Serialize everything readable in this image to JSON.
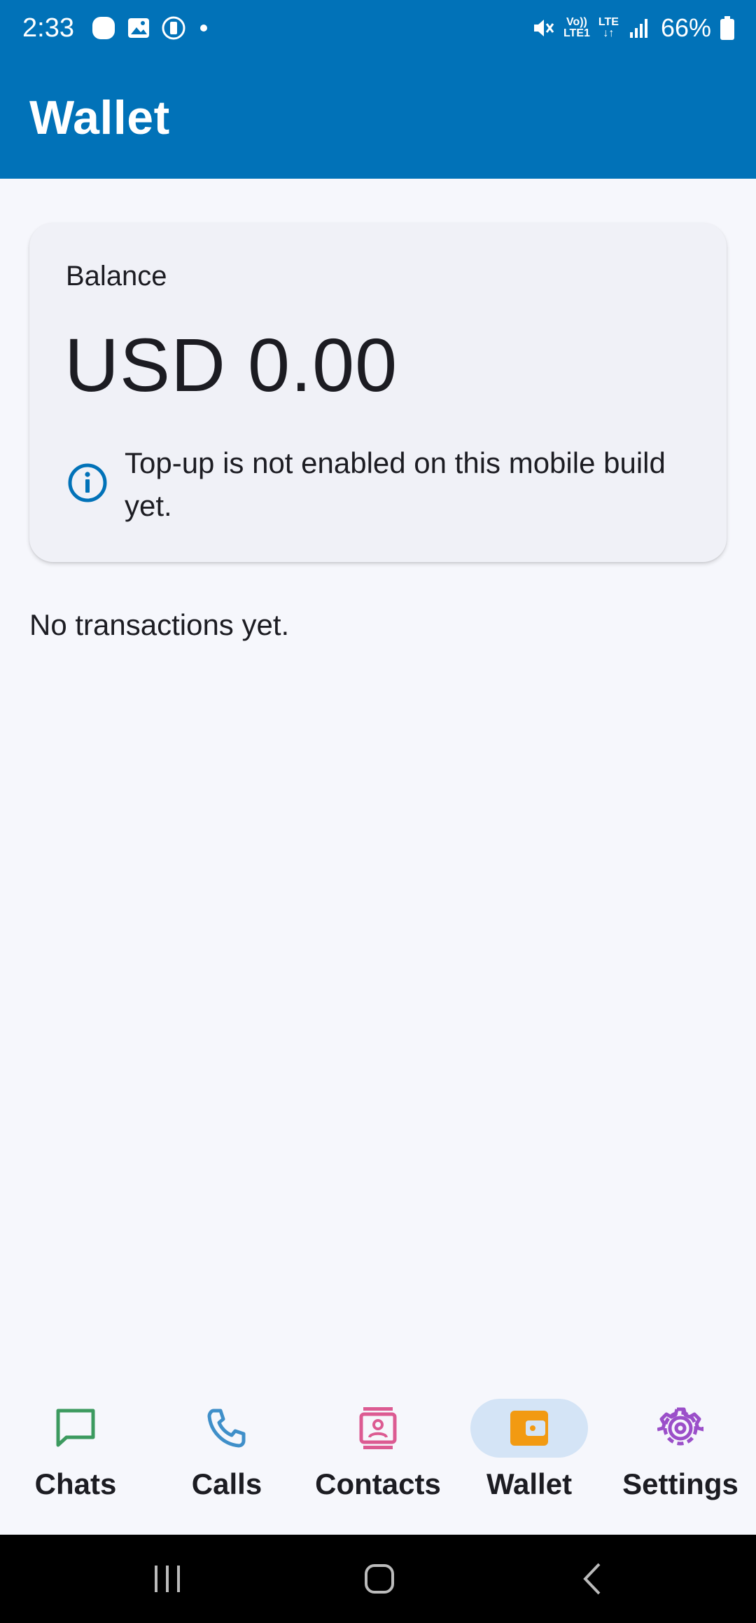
{
  "status_bar": {
    "time": "2:33",
    "battery": "66%",
    "icons": [
      "notification-bubble-icon",
      "gallery-icon",
      "screenshot-icon",
      "mute-icon",
      "volte-icon",
      "lte-icon",
      "signal-icon",
      "battery-icon"
    ],
    "volte_line1": "Vo))",
    "volte_line2": "LTE1",
    "lte_label": "LTE"
  },
  "app_bar": {
    "title": "Wallet"
  },
  "balance_card": {
    "label": "Balance",
    "amount": "USD 0.00",
    "info": "Top-up is not enabled on this mobile build yet."
  },
  "transactions": {
    "empty_text": "No transactions yet."
  },
  "bottom_nav": {
    "items": [
      {
        "label": "Chats",
        "icon": "chat-icon",
        "color": "#3C9A5F",
        "active": false
      },
      {
        "label": "Calls",
        "icon": "phone-icon",
        "color": "#3F8FC9",
        "active": false
      },
      {
        "label": "Contacts",
        "icon": "contacts-icon",
        "color": "#DC5B92",
        "active": false
      },
      {
        "label": "Wallet",
        "icon": "wallet-icon",
        "color": "#F29A12",
        "active": true
      },
      {
        "label": "Settings",
        "icon": "gear-icon",
        "color": "#9B4FC9",
        "active": false
      }
    ]
  },
  "colors": {
    "primary": "#0172B8",
    "background": "#F6F7FC",
    "card": "#F0F1F7",
    "active_pill": "#D4E4F6"
  }
}
